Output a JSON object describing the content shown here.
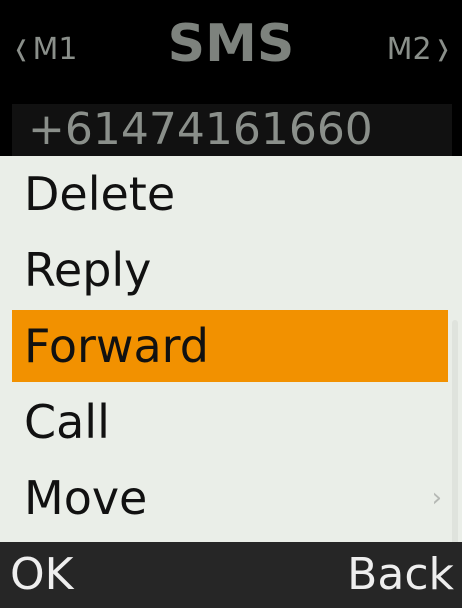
{
  "header": {
    "left_label": "M1",
    "title": "SMS",
    "right_label": "M2",
    "left_icon": "chevron-left-icon",
    "right_icon": "chevron-right-icon"
  },
  "message": {
    "number": "+61474161660"
  },
  "menu": {
    "items": [
      {
        "label": "Delete"
      },
      {
        "label": "Reply"
      },
      {
        "label": "Forward",
        "selected": true
      },
      {
        "label": "Call"
      },
      {
        "label": "Move",
        "has_submenu": true
      }
    ],
    "submenu_arrow": "›"
  },
  "softkeys": {
    "left": "OK",
    "right": "Back"
  },
  "colors": {
    "selection": "#f29100",
    "menu_background": "#eaeee8",
    "header_background": "#000000",
    "softkey_background": "#262626"
  }
}
